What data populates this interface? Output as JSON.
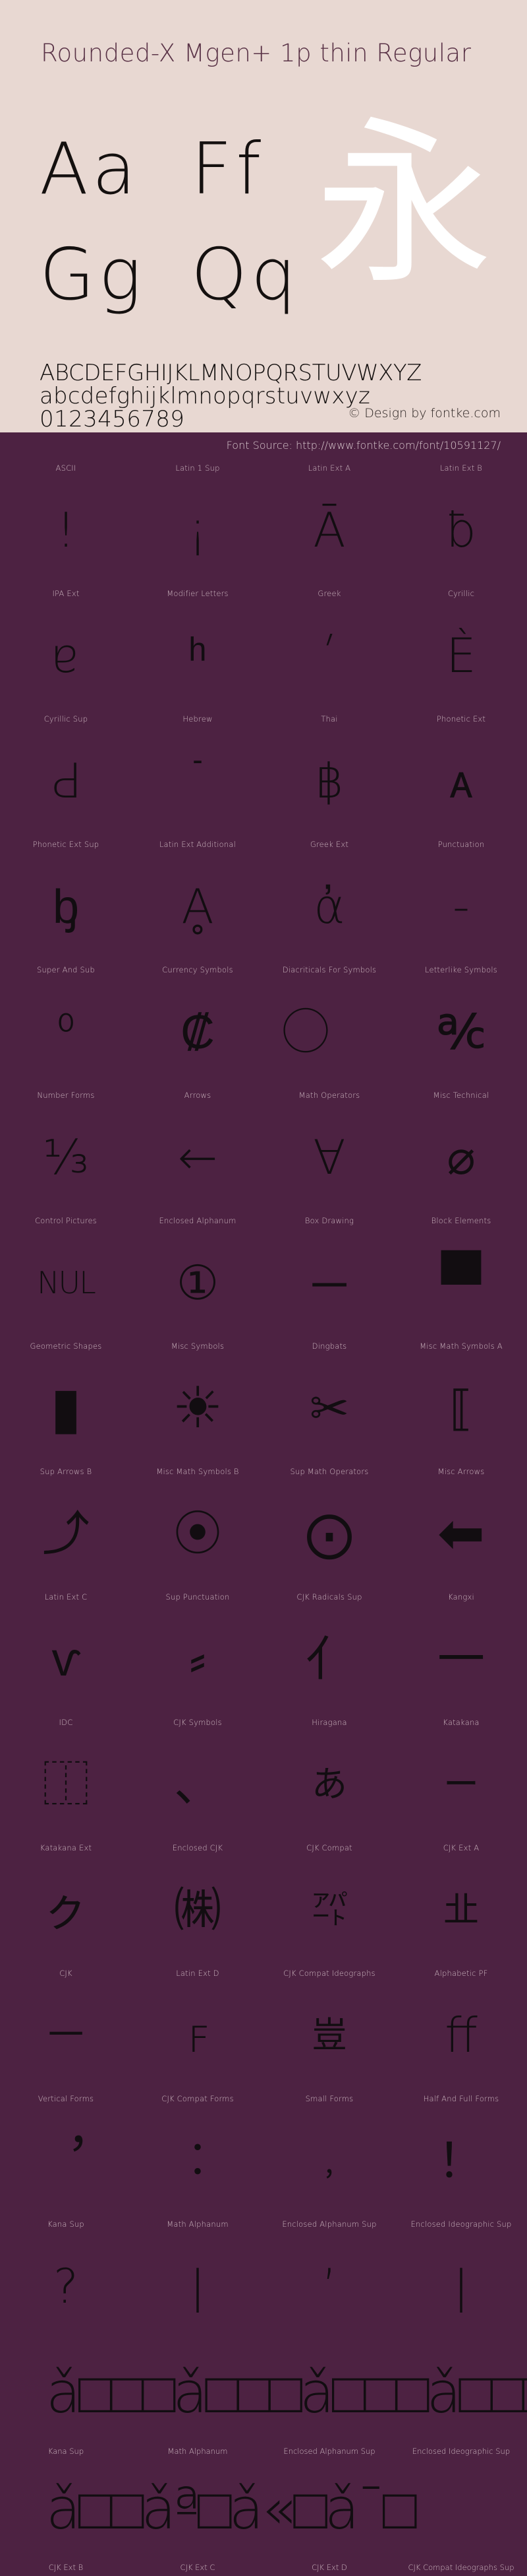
{
  "header": {
    "font_title": "Rounded-X Mgen+ 1p thin Regular",
    "background_color": "#e8d8d2",
    "text_color": "#5a3347",
    "specimen_pairs": [
      {
        "name": "Aa",
        "text": "Aa"
      },
      {
        "name": "Ff",
        "text": "Ff"
      },
      {
        "name": "Gg",
        "text": "Gg"
      },
      {
        "name": "Qq",
        "text": "Qq"
      }
    ],
    "cjk_sample": "永",
    "cjk_sample_color": "#ffffff",
    "alphabet_upper": "ABCDEFGHIJKLMNOPQRSTUVWXYZ",
    "alphabet_lower": "abcdefghijklmnopqrstuvwxyz",
    "digits": "0123456789",
    "copyright": "© Design by fontke.com"
  },
  "source": {
    "label": "Font Source: http://www.fontke.com/font/10591127/",
    "bar_color": "#4d2242",
    "text_color": "#d8c7cd"
  },
  "blocks": {
    "accent_color": "#4d2242",
    "label_color": "#cdb7c0",
    "glyph_color": "#120d11",
    "rows": [
      [
        {
          "label": "ASCII",
          "glyph": "!"
        },
        {
          "label": "Latin 1 Sup",
          "glyph": "¡"
        },
        {
          "label": "Latin Ext A",
          "glyph": "Ā"
        },
        {
          "label": "Latin Ext B",
          "glyph": "ƀ"
        }
      ],
      [
        {
          "label": "IPA Ext",
          "glyph": "ɐ"
        },
        {
          "label": "Modifier Letters",
          "glyph": "ʰ"
        },
        {
          "label": "Greek",
          "glyph": "ʹ"
        },
        {
          "label": "Cyrillic",
          "glyph": "Ѐ"
        }
      ],
      [
        {
          "label": "Cyrillic Sup",
          "glyph": "Ԁ"
        },
        {
          "label": "Hebrew",
          "glyph": "ֿ"
        },
        {
          "label": "Thai",
          "glyph": "฿"
        },
        {
          "label": "Phonetic Ext",
          "glyph": "ᴀ"
        }
      ],
      [
        {
          "label": "Phonetic Ext Sup",
          "glyph": "ᶀ"
        },
        {
          "label": "Latin Ext Additional",
          "glyph": "Ḁ"
        },
        {
          "label": "Greek Ext",
          "glyph": "ἀ"
        },
        {
          "label": "Punctuation",
          "glyph": "‐"
        }
      ],
      [
        {
          "label": "Super And Sub",
          "glyph": "⁰"
        },
        {
          "label": "Currency Symbols",
          "glyph": "₡"
        },
        {
          "label": "Diacriticals For Symbols",
          "glyph": "⃝"
        },
        {
          "label": "Letterlike Symbols",
          "glyph": "℀"
        }
      ],
      [
        {
          "label": "Number Forms",
          "glyph": "⅓"
        },
        {
          "label": "Arrows",
          "glyph": "←"
        },
        {
          "label": "Math Operators",
          "glyph": "∀"
        },
        {
          "label": "Misc Technical",
          "glyph": "⌀"
        }
      ],
      [
        {
          "label": "Control Pictures",
          "glyph": "NUL"
        },
        {
          "label": "Enclosed Alphanum",
          "glyph": "①"
        },
        {
          "label": "Box Drawing",
          "glyph": "─"
        },
        {
          "label": "Block Elements",
          "glyph": "▀"
        }
      ],
      [
        {
          "label": "Geometric Shapes",
          "glyph": "▮"
        },
        {
          "label": "Misc Symbols",
          "glyph": "☀"
        },
        {
          "label": "Dingbats",
          "glyph": "✂"
        },
        {
          "label": "Misc Math Symbols A",
          "glyph": "⟦"
        }
      ],
      [
        {
          "label": "Sup Arrows B",
          "glyph": "⤴"
        },
        {
          "label": "Misc Math Symbols B",
          "glyph": "⦿"
        },
        {
          "label": "Sup Math Operators",
          "glyph": "⨀"
        },
        {
          "label": "Misc Arrows",
          "glyph": "⬅"
        }
      ],
      [
        {
          "label": "Latin Ext C",
          "glyph": "ⱱ"
        },
        {
          "label": "Sup Punctuation",
          "glyph": "⸗"
        },
        {
          "label": "CJK Radicals Sup",
          "glyph": "⺅"
        },
        {
          "label": "Kangxi",
          "glyph": "⼀"
        }
      ],
      [
        {
          "label": "IDC",
          "glyph": "⿰"
        },
        {
          "label": "CJK Symbols",
          "glyph": "、"
        },
        {
          "label": "Hiragana",
          "glyph": "あ"
        },
        {
          "label": "Katakana",
          "glyph": "ー"
        }
      ],
      [
        {
          "label": "Katakana Ext",
          "glyph": "ㇰ"
        },
        {
          "label": "Enclosed CJK",
          "glyph": "㈱"
        },
        {
          "label": "CJK Compat",
          "glyph": "㌀"
        },
        {
          "label": "CJK Ext A",
          "glyph": "㐀"
        }
      ],
      [
        {
          "label": "CJK",
          "glyph": "一"
        },
        {
          "label": "Latin Ext D",
          "glyph": "ꜰ"
        },
        {
          "label": "CJK Compat Ideographs",
          "glyph": "豈"
        },
        {
          "label": "Alphabetic PF",
          "glyph": "ﬀ"
        }
      ],
      [
        {
          "label": "Vertical Forms",
          "glyph": "︐"
        },
        {
          "label": "CJK Compat Forms",
          "glyph": "︰"
        },
        {
          "label": "Small Forms",
          "glyph": "﹐"
        },
        {
          "label": "Half And Full Forms",
          "glyph": "！"
        }
      ],
      [
        {
          "label": "Kana Sup",
          "glyph": "?"
        },
        {
          "label": "Math Alphanum",
          "glyph": "ǀ"
        },
        {
          "label": "Enclosed Alphanum Sup",
          "glyph": "’"
        },
        {
          "label": "Enclosed Ideographic Sup",
          "glyph": "ǀ"
        }
      ]
    ],
    "overflow_rows": [
      {
        "glyphs": "ǎ□□□ǎ□□□ǎ□□□ǎ□□□",
        "labels": [
          "Kana Sup",
          "Math Alphanum",
          "Enclosed Alphanum Sup",
          "Enclosed Ideographic Sup"
        ]
      },
      {
        "glyphs": "ǎ□□ǎª□ǎ«□ǎ¯□",
        "labels": [
          "CJK Ext B",
          "CJK Ext C",
          "CJK Ext D",
          "CJK Compat Ideographs Sup"
        ]
      }
    ]
  }
}
